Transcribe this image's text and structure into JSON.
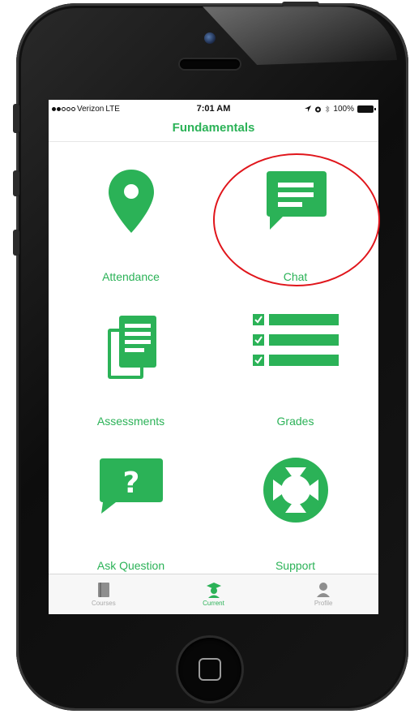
{
  "status_bar": {
    "carrier": "Verizon",
    "network": "LTE",
    "time": "7:01 AM",
    "battery": "100%"
  },
  "nav": {
    "title": "Fundamentals"
  },
  "tiles": [
    {
      "label": "Attendance",
      "icon": "location-pin-icon"
    },
    {
      "label": "Chat",
      "icon": "chat-bubble-icon"
    },
    {
      "label": "Assessments",
      "icon": "documents-icon"
    },
    {
      "label": "Grades",
      "icon": "checklist-icon"
    },
    {
      "label": "Ask Question",
      "icon": "question-bubble-icon"
    },
    {
      "label": "Support",
      "icon": "lifebuoy-icon"
    }
  ],
  "tabbar": {
    "tabs": [
      {
        "label": "Courses",
        "icon": "book-icon",
        "active": false
      },
      {
        "label": "Current",
        "icon": "graduate-icon",
        "active": true
      },
      {
        "label": "Profile",
        "icon": "person-icon",
        "active": false
      }
    ]
  },
  "colors": {
    "accent": "#2bb257",
    "highlight": "#e0151b",
    "inactive": "#a9a9a9"
  }
}
